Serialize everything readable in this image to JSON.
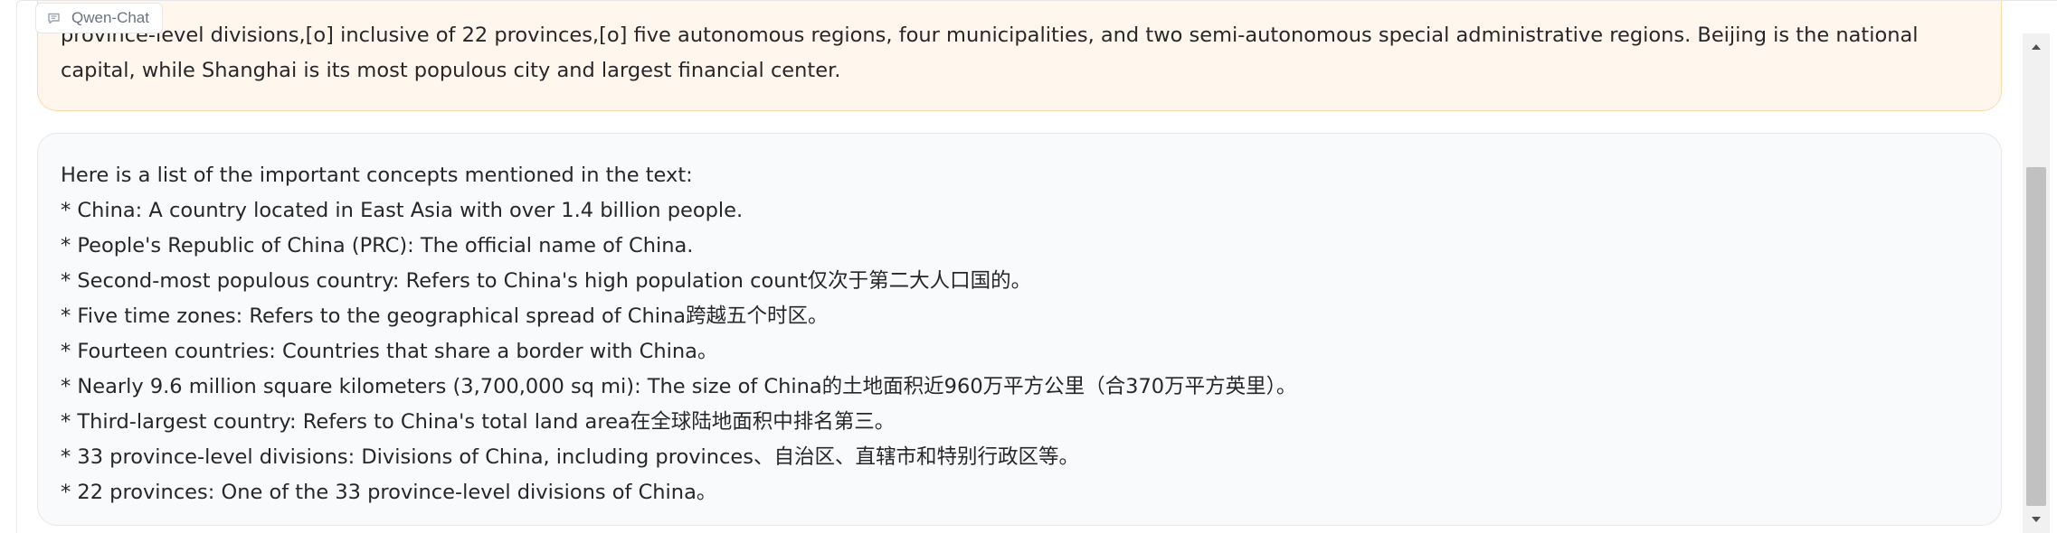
{
  "tab": {
    "label": "Qwen-Chat",
    "icon": "chat-icon"
  },
  "user_message": {
    "lines": [
      "province-level divisions,[o] inclusive of 22 provinces,[o] five autonomous regions, four municipalities, and two semi-autonomous special administrative regions. Beijing is the national capital, while Shanghai is its most populous city and largest financial center."
    ]
  },
  "bot_message": {
    "lines": [
      "Here is a list of the important concepts mentioned in the text:",
      "* China: A country located in East Asia with over 1.4 billion people.",
      "* People's Republic of China (PRC): The official name of China.",
      "* Second-most populous country: Refers to China's high population count仅次于第二大人口国的。",
      "* Five time zones: Refers to the geographical spread of China跨越五个时区。",
      "* Fourteen countries: Countries that share a border with China。",
      "* Nearly 9.6 million square kilometers (3,700,000 sq mi): The size of China的土地面积近960万平方公里（合370万平方英里）。",
      "* Third-largest country: Refers to China's total land area在全球陆地面积中排名第三。",
      "* 33 province-level divisions: Divisions of China, including provinces、自治区、直辖市和特别行政区等。",
      "* 22 provinces: One of the 33 province-level divisions of China。"
    ]
  },
  "scrollbar": {
    "up_icon": "triangle-up-icon",
    "down_icon": "triangle-down-icon"
  },
  "colors": {
    "user_bubble_bg": "#fff7ed",
    "user_bubble_border": "#fed7aa",
    "bot_bubble_bg": "#f8fafc",
    "bot_bubble_border": "#e5e7eb"
  }
}
